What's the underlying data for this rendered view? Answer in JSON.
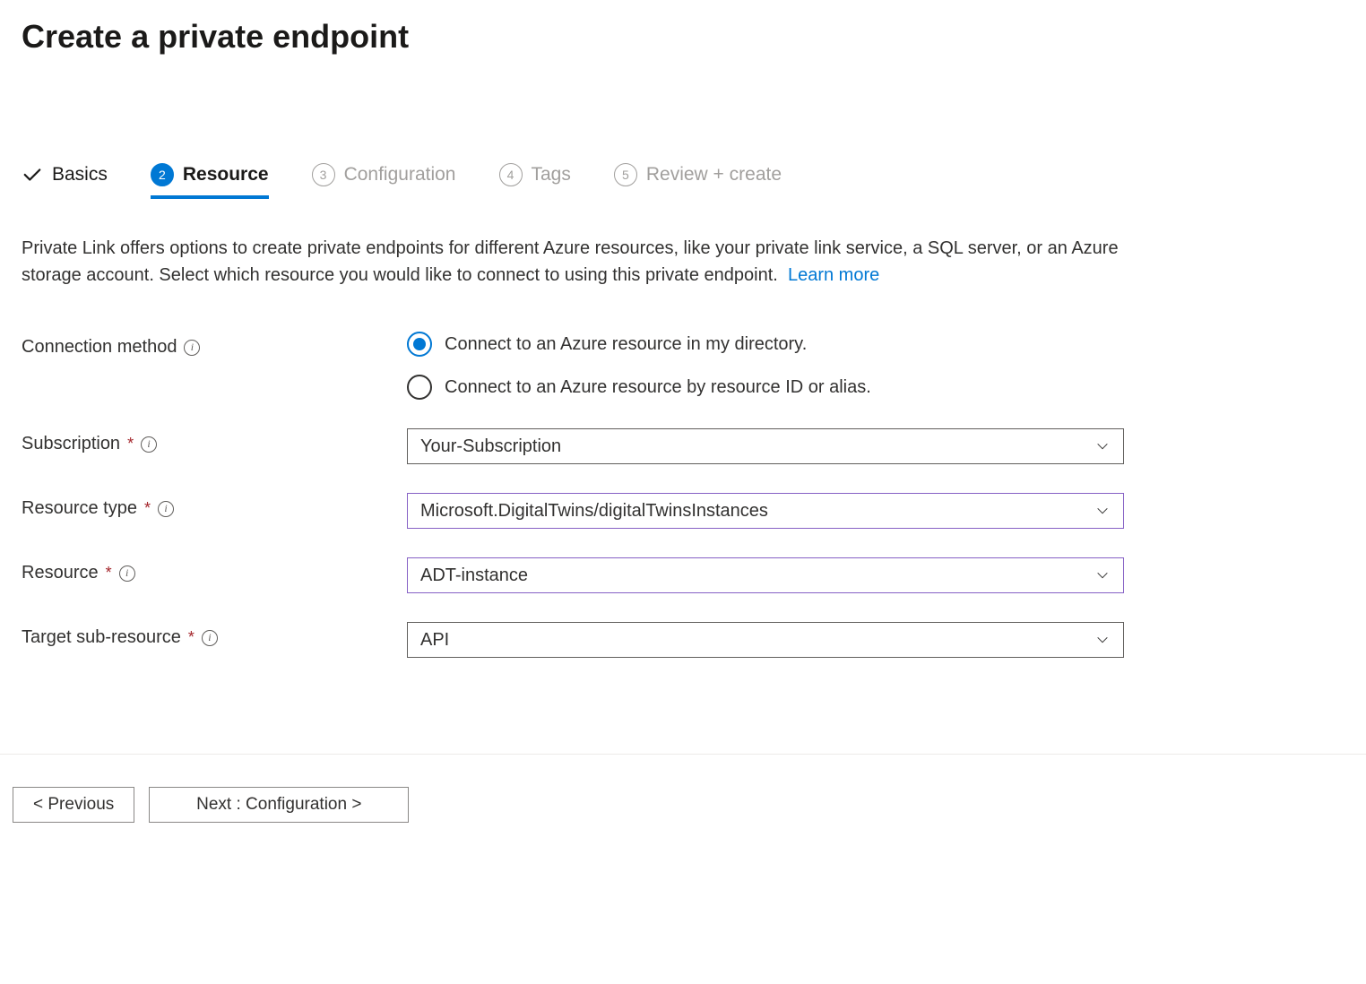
{
  "page": {
    "title": "Create a private endpoint"
  },
  "tabs": [
    {
      "label": "Basics",
      "state": "completed"
    },
    {
      "label": "Resource",
      "state": "active",
      "number": "2"
    },
    {
      "label": "Configuration",
      "state": "disabled",
      "number": "3"
    },
    {
      "label": "Tags",
      "state": "disabled",
      "number": "4"
    },
    {
      "label": "Review + create",
      "state": "disabled",
      "number": "5"
    }
  ],
  "description": {
    "text": "Private Link offers options to create private endpoints for different Azure resources, like your private link service, a SQL server, or an Azure storage account. Select which resource you would like to connect to using this private endpoint.",
    "learn_more": "Learn more"
  },
  "form": {
    "connection_method": {
      "label": "Connection method",
      "options": [
        {
          "label": "Connect to an Azure resource in my directory.",
          "selected": true
        },
        {
          "label": "Connect to an Azure resource by resource ID or alias.",
          "selected": false
        }
      ]
    },
    "subscription": {
      "label": "Subscription",
      "value": "Your-Subscription"
    },
    "resource_type": {
      "label": "Resource type",
      "value": "Microsoft.DigitalTwins/digitalTwinsInstances"
    },
    "resource": {
      "label": "Resource",
      "value": "ADT-instance"
    },
    "target_sub_resource": {
      "label": "Target sub-resource",
      "value": "API"
    }
  },
  "footer": {
    "previous": "< Previous",
    "next": "Next : Configuration >"
  }
}
